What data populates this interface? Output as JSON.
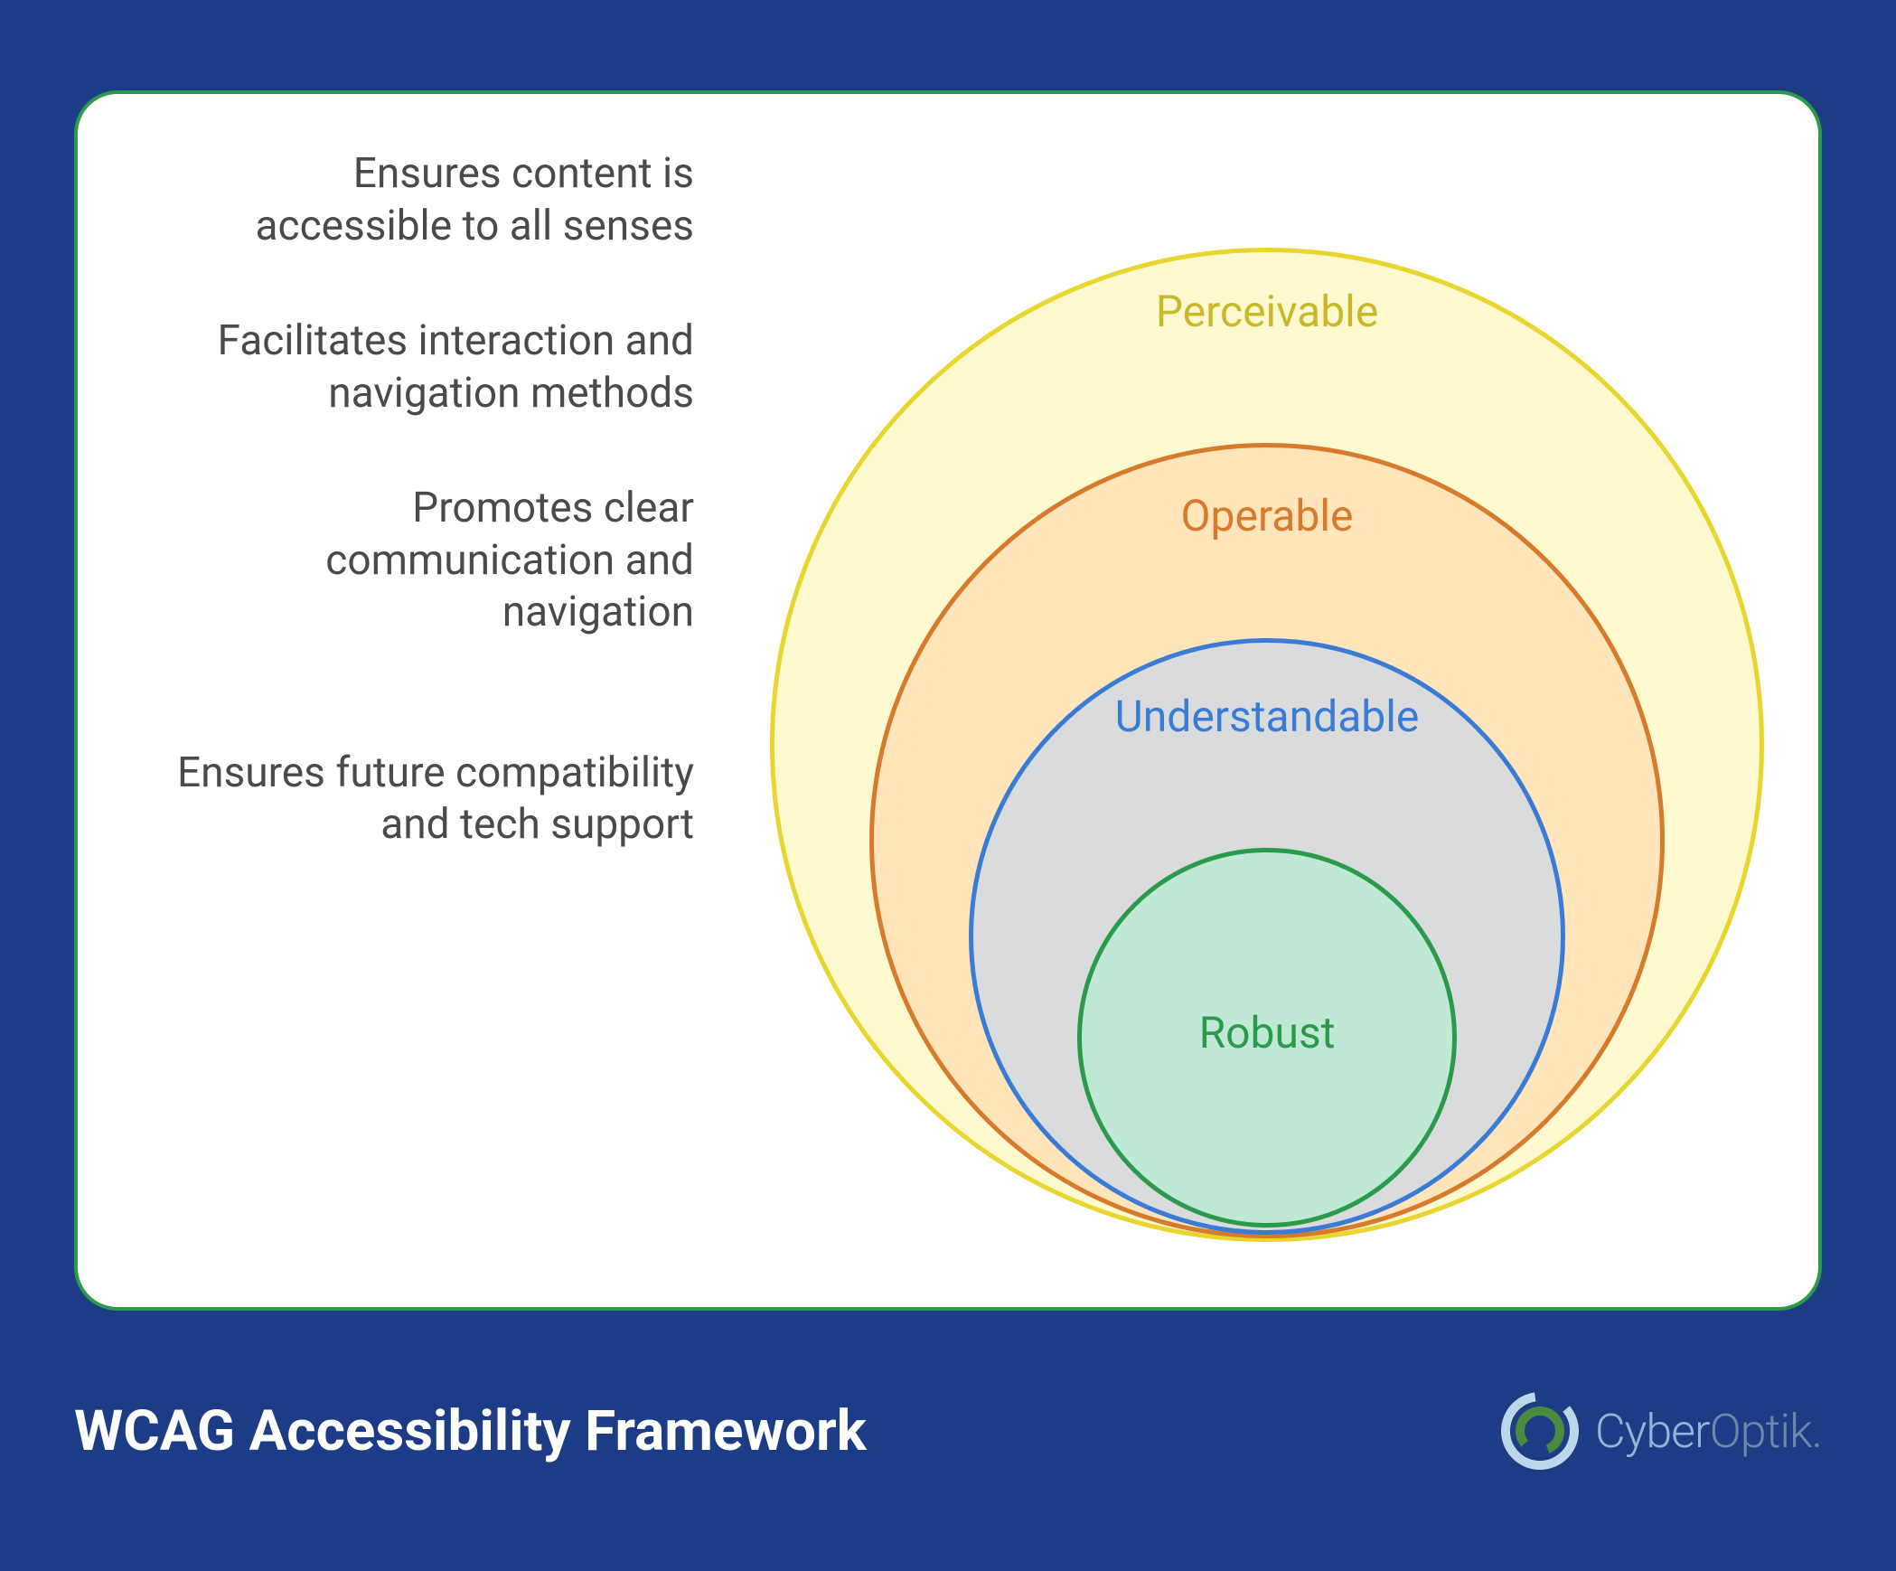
{
  "title": "WCAG Accessibility Framework",
  "brand": {
    "name_part1": "Cyber",
    "name_part2": "Optik."
  },
  "colors": {
    "background": "#1d3c86",
    "card_border": "#2b9a4a",
    "perceivable": "#e8d62e",
    "operable": "#d67a2c",
    "understandable": "#3a7bd5",
    "robust": "#2b9a4a"
  },
  "rings": [
    {
      "label": "Perceivable",
      "description": "Ensures content is accessible to all senses"
    },
    {
      "label": "Operable",
      "description": "Facilitates interaction and navigation methods"
    },
    {
      "label": "Understandable",
      "description": "Promotes clear communication and navigation"
    },
    {
      "label": "Robust",
      "description": "Ensures future compatibility and tech support"
    }
  ]
}
